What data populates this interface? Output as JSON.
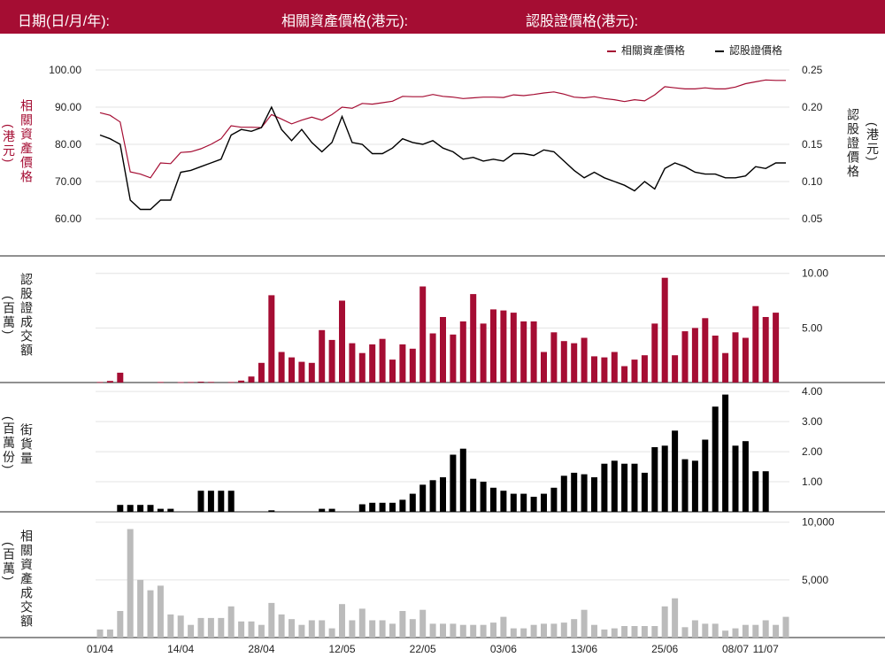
{
  "header": {
    "date_label": "日期(日/月/年):",
    "underlying_label": "相關資產價格(港元):",
    "warrant_label": "認股證價格(港元):"
  },
  "legend": {
    "underlying": "相關資產價格",
    "warrant": "認股證價格"
  },
  "labels": {
    "price_left": "相關資產價格",
    "price_left_unit": "(港元)",
    "price_right": "認股證價格",
    "price_right_unit": "(港元)",
    "warrant_turnover": "認股證成交額",
    "warrant_turnover_unit": "(百萬)",
    "outstanding": "街貨量",
    "outstanding_unit": "(百萬份)",
    "underlying_turnover": "相關資產成交額",
    "underlying_turnover_unit": "(百萬)"
  },
  "colors": {
    "header_bg": "#a50d33",
    "underlying": "#a50d33",
    "warrant": "#000000",
    "outstanding": "#000000",
    "underlying_turnover": "#bbbbbb"
  },
  "chart_data": [
    {
      "type": "line",
      "x_ticks": [
        "01/04",
        "14/04",
        "28/04",
        "12/05",
        "22/05",
        "03/06",
        "13/06",
        "25/06",
        "08/07",
        "11/07"
      ],
      "x_tick_index": [
        0,
        8,
        16,
        24,
        32,
        40,
        48,
        56,
        63,
        66
      ],
      "left_axis": {
        "ylim": [
          55,
          105
        ],
        "ticks": [
          "100.00",
          "90.00",
          "80.00",
          "70.00",
          "60.00"
        ],
        "tick_values": [
          100,
          90,
          80,
          70,
          60
        ]
      },
      "right_axis": {
        "ylim": [
          0.0125,
          0.2625
        ],
        "ticks": [
          "0.25",
          "0.20",
          "0.15",
          "0.10",
          "0.05"
        ],
        "tick_values": [
          0.25,
          0.2,
          0.15,
          0.1,
          0.05
        ]
      },
      "series": [
        {
          "name": "相關資產價格",
          "axis": "left",
          "values": [
            88.5,
            87.8,
            86.0,
            72.6,
            72.0,
            71.0,
            75.0,
            74.8,
            77.8,
            78.0,
            78.8,
            80.0,
            81.5,
            85.0,
            84.6,
            84.6,
            84.5,
            88.0,
            86.8,
            85.5,
            86.5,
            87.3,
            86.5,
            88.0,
            90.0,
            89.7,
            91.0,
            90.8,
            91.2,
            91.6,
            92.9,
            92.8,
            92.8,
            93.4,
            92.9,
            92.7,
            92.3,
            92.5,
            92.7,
            92.7,
            92.6,
            93.3,
            93.1,
            93.4,
            93.8,
            94.1,
            93.5,
            92.7,
            92.5,
            92.8,
            92.3,
            92.0,
            91.5,
            92.0,
            91.7,
            93.3,
            95.5,
            95.2,
            94.9,
            94.9,
            95.2,
            94.9,
            94.9,
            95.4,
            96.3,
            96.8,
            97.3,
            97.2,
            97.2
          ]
        },
        {
          "name": "認股證價格",
          "axis": "right",
          "values": [
            0.1625,
            0.1575,
            0.15,
            0.075,
            0.0625,
            0.0625,
            0.075,
            0.075,
            0.1125,
            0.115,
            0.12,
            0.125,
            0.13,
            0.1625,
            0.17,
            0.1675,
            0.1725,
            0.2,
            0.17,
            0.155,
            0.17,
            0.1525,
            0.14,
            0.1525,
            0.1875,
            0.1525,
            0.15,
            0.1375,
            0.1375,
            0.145,
            0.1575,
            0.1525,
            0.15,
            0.155,
            0.145,
            0.14,
            0.13,
            0.1325,
            0.1275,
            0.13,
            0.1275,
            0.1375,
            0.1375,
            0.135,
            0.1425,
            0.14,
            0.1275,
            0.115,
            0.105,
            0.1125,
            0.105,
            0.1,
            0.095,
            0.0875,
            0.1,
            0.09,
            0.1175,
            0.125,
            0.12,
            0.1125,
            0.11,
            0.11,
            0.105,
            0.105,
            0.1075,
            0.12,
            0.1175,
            0.125,
            0.125
          ]
        }
      ]
    },
    {
      "type": "bar",
      "name": "認股證成交額",
      "ylim": [
        0,
        11.6
      ],
      "ticks": [
        "10.00",
        "5.00"
      ],
      "tick_values": [
        10,
        5
      ],
      "values": [
        0.05,
        0.15,
        0.9,
        0,
        0,
        0,
        0.05,
        0,
        0.04,
        0.05,
        0.08,
        0.06,
        0,
        0.05,
        0.18,
        0.55,
        1.8,
        8.0,
        2.8,
        2.3,
        1.9,
        1.8,
        4.8,
        3.9,
        7.5,
        3.6,
        2.7,
        3.5,
        4.0,
        2.1,
        3.5,
        3.1,
        8.8,
        4.5,
        6.0,
        4.4,
        5.6,
        8.1,
        5.4,
        6.7,
        6.6,
        6.4,
        5.6,
        5.6,
        2.8,
        4.6,
        3.8,
        3.6,
        4.1,
        2.4,
        2.3,
        2.8,
        1.5,
        2.1,
        2.5,
        5.4,
        9.6,
        2.5,
        4.7,
        5.0,
        5.9,
        4.3,
        2.7,
        4.6,
        4.1,
        7.0,
        6.0,
        6.4
      ]
    },
    {
      "type": "bar",
      "name": "街貨量",
      "ylim": [
        0,
        4.3
      ],
      "ticks": [
        "4.00",
        "3.00",
        "2.00",
        "1.00"
      ],
      "tick_values": [
        4,
        3,
        2,
        1
      ],
      "values": [
        0,
        0,
        0.23,
        0.23,
        0.23,
        0.23,
        0.1,
        0.1,
        0,
        0,
        0.7,
        0.7,
        0.7,
        0.7,
        0,
        0,
        0,
        0.05,
        0,
        0,
        0,
        0,
        0.1,
        0.1,
        0,
        0,
        0.25,
        0.3,
        0.3,
        0.3,
        0.4,
        0.6,
        0.9,
        1.05,
        1.15,
        1.9,
        2.1,
        1.1,
        1.0,
        0.8,
        0.7,
        0.6,
        0.6,
        0.5,
        0.6,
        0.8,
        1.2,
        1.3,
        1.25,
        1.15,
        1.6,
        1.7,
        1.6,
        1.6,
        1.3,
        2.15,
        2.2,
        2.7,
        1.75,
        1.7,
        2.4,
        3.5,
        3.9,
        2.2,
        2.35,
        1.35,
        1.35
      ]
    },
    {
      "type": "bar",
      "name": "相關資產成交額",
      "ylim": [
        0,
        10900
      ],
      "ticks": [
        "10,000",
        "5,000"
      ],
      "tick_values": [
        10000,
        5000
      ],
      "values": [
        700,
        700,
        2300,
        9400,
        5000,
        4100,
        4500,
        2000,
        1900,
        1100,
        1700,
        1700,
        1700,
        2700,
        1400,
        1400,
        1100,
        3000,
        2000,
        1600,
        1100,
        1500,
        1500,
        800,
        2900,
        1500,
        2500,
        1500,
        1500,
        1200,
        2300,
        1600,
        2400,
        1200,
        1200,
        1200,
        1100,
        1100,
        1100,
        1300,
        1800,
        800,
        800,
        1100,
        1200,
        1200,
        1300,
        1600,
        2400,
        1100,
        700,
        800,
        1000,
        1000,
        1000,
        1000,
        2700,
        3400,
        900,
        1500,
        1200,
        1200,
        600,
        800,
        1100,
        1100,
        1500,
        1100,
        1800
      ]
    }
  ]
}
